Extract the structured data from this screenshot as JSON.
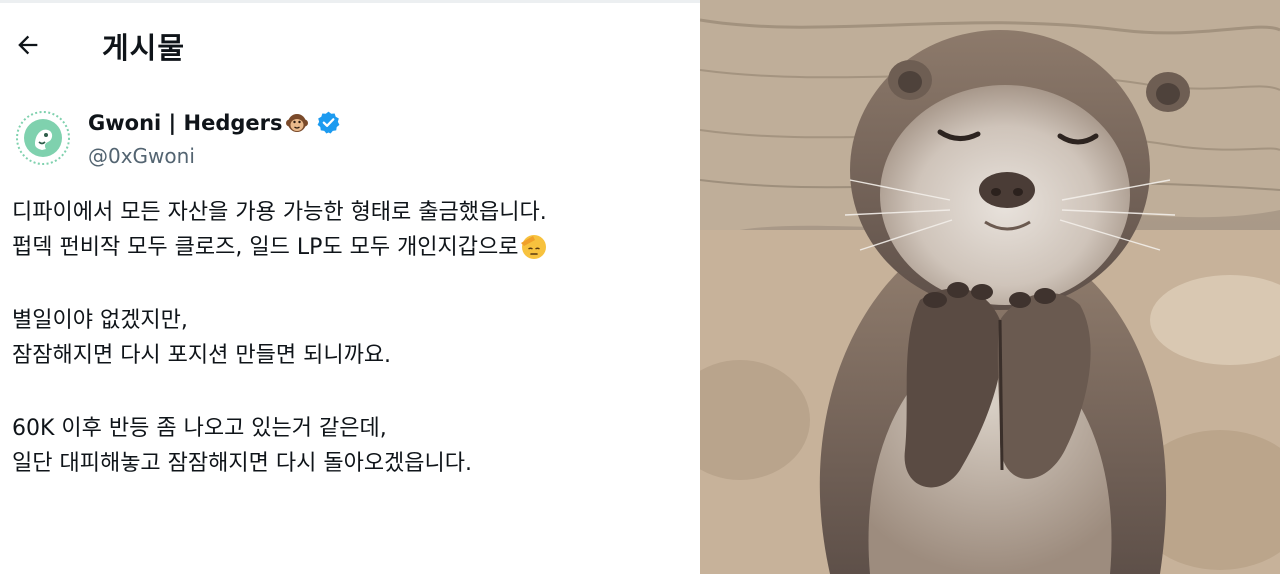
{
  "header": {
    "title": "게시물",
    "back_icon": "arrow-left-icon"
  },
  "author": {
    "display_name": "Gwoni | Hedgers",
    "name_emoji": "monkey-face-icon",
    "verified_icon": "verified-badge-icon",
    "handle": "@0xGwoni",
    "avatar_icon": "avatar-logo-icon"
  },
  "tweet": {
    "paragraphs": [
      {
        "line1": "디파이에서 모든 자산을 가용 가능한 형태로 출금했읍니다.",
        "line2": "펍덱 펀비작 모두 클로즈, 일드 LP도 모두 개인지갑으로"
      },
      {
        "line1": "별일이야 없겠지만,",
        "line2": "잠잠해지면 다시 포지션 만들면 되니까요."
      },
      {
        "line1": "60K 이후 반등 좀 나오고 있는거 같은데,",
        "line2": "일단 대피해놓고 잠잠해지면 다시 돌아오겠읍니다."
      }
    ],
    "trailing_emoji": "saluting-face-icon"
  },
  "photo": {
    "subject_icon": "otter-praying-photo"
  },
  "colors": {
    "text": "#0f1419",
    "secondary_text": "#536471",
    "verified_blue": "#1d9bf0",
    "avatar_green": "#7fd1ae"
  }
}
